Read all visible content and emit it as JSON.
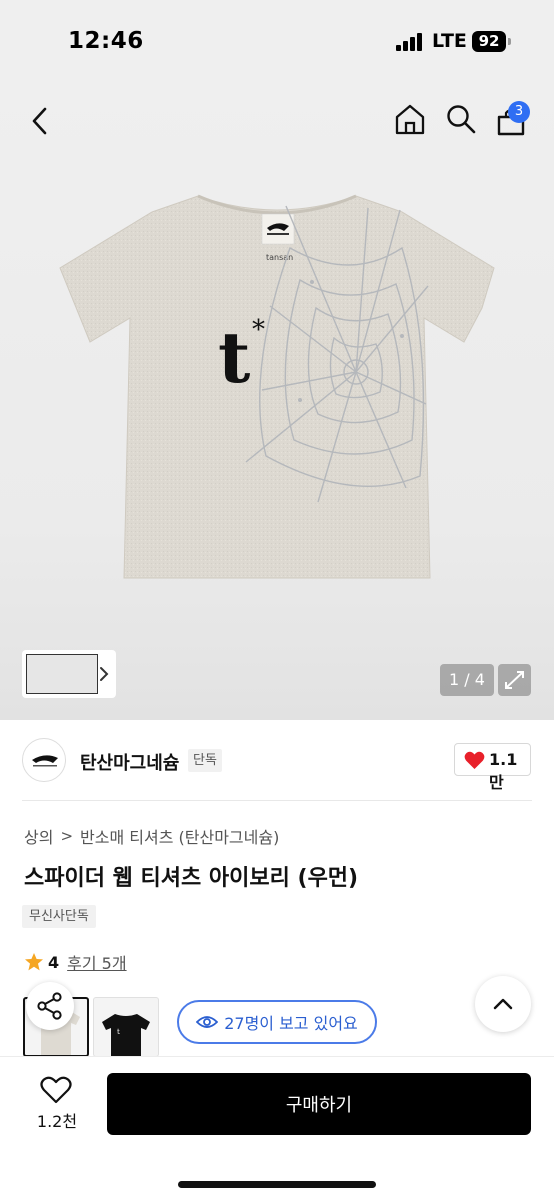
{
  "status_bar": {
    "time": "12:46",
    "network": "LTE",
    "battery": "92"
  },
  "top_nav": {
    "cart_count": "3"
  },
  "gallery": {
    "page_indicator": "1 / 4"
  },
  "brand": {
    "name": "탄산마그네슘",
    "tag": "단독",
    "likes": "1.1만"
  },
  "breadcrumb": {
    "category": "상의",
    "subcategory": "반소매 티셔츠 (탄산마그네슘)"
  },
  "product": {
    "title": "스파이더 웹 티셔츠 아이보리 (우먼)",
    "badge": "무신사단독",
    "rating": "4",
    "review_link": "후기 5개",
    "viewers": "27명이 보고 있어요"
  },
  "bottom_bar": {
    "wish_count": "1.2천",
    "buy_label": "구매하기"
  },
  "colors": {
    "accent": "#2f6ef3",
    "viewer_blue": "#2b5fd0",
    "heart": "#e8202a",
    "star": "#f5a623"
  }
}
